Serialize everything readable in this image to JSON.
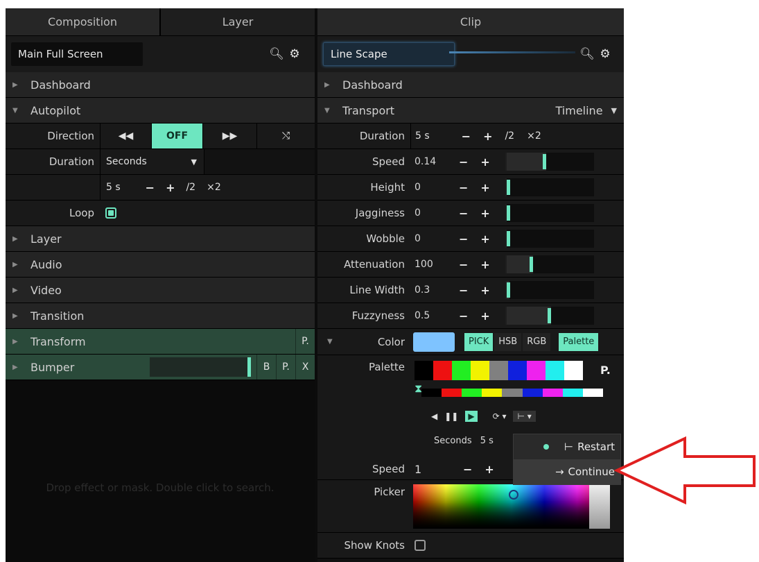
{
  "left": {
    "tabs": [
      "Composition",
      "Layer"
    ],
    "name": "Main Full Screen",
    "sections_top": [
      "Dashboard",
      "Autopilot"
    ],
    "direction": {
      "label": "Direction",
      "off": "OFF"
    },
    "duration": {
      "label": "Duration",
      "select": "Seconds",
      "value": "5 s",
      "minus": "−",
      "plus": "+",
      "half": "/2",
      "double": "×2"
    },
    "loop": {
      "label": "Loop"
    },
    "sections": [
      "Layer",
      "Audio",
      "Video",
      "Transition",
      "Transform",
      "Bumper"
    ],
    "transform_btn": "P.",
    "bumper_btns": [
      "B",
      "P.",
      "X"
    ],
    "drop_hint": "Drop effect or mask. Double click to search."
  },
  "right": {
    "tab": "Clip",
    "name": "Line Scape",
    "dashboard": "Dashboard",
    "transport": {
      "label": "Transport",
      "mode": "Timeline"
    },
    "duration": {
      "label": "Duration",
      "value": "5 s",
      "half": "/2",
      "double": "×2"
    },
    "params": [
      {
        "label": "Speed",
        "value": "0.14",
        "level": 0.45
      },
      {
        "label": "Height",
        "value": "0",
        "level": 0
      },
      {
        "label": "Jagginess",
        "value": "0",
        "level": 0
      },
      {
        "label": "Wobble",
        "value": "0",
        "level": 0
      },
      {
        "label": "Attenuation",
        "value": "100",
        "level": 0.3
      },
      {
        "label": "Line Width",
        "value": "0.3",
        "level": 0.03
      },
      {
        "label": "Fuzzyness",
        "value": "0.5",
        "level": 0.5
      }
    ],
    "color": {
      "label": "Color",
      "modes": [
        "PICK",
        "HSB",
        "RGB"
      ],
      "palette_btn": "Palette"
    },
    "palette": {
      "label": "Palette",
      "p_btn": "P.",
      "colors": [
        "#000000",
        "#ee1111",
        "#22ee22",
        "#f2f200",
        "#808080",
        "#1020dd",
        "#ee22ee",
        "#22eeee",
        "#ffffff"
      ]
    },
    "playback": {
      "seconds_label": "Seconds",
      "seconds_value": "5 s"
    },
    "speed": {
      "label": "Speed",
      "value": "1"
    },
    "picker": {
      "label": "Picker"
    },
    "show_knots": {
      "label": "Show Knots"
    }
  },
  "popup": {
    "items": [
      "Restart",
      "Continue"
    ]
  }
}
